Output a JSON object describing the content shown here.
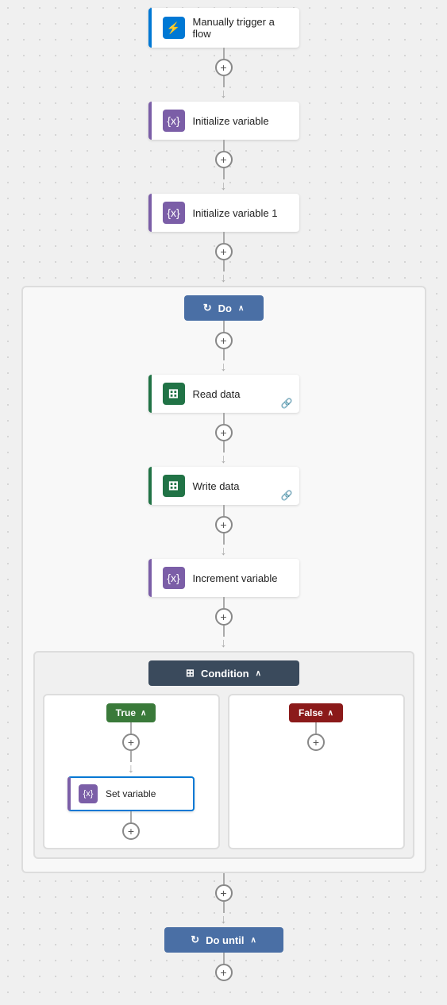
{
  "trigger": {
    "label": "Manually trigger a flow",
    "icon": "⚡",
    "iconColor": "#0078d4"
  },
  "initVariable": {
    "label": "Initialize variable",
    "iconLabel": "{x}",
    "iconColor": "#7B5EA7"
  },
  "initVariable1": {
    "label": "Initialize variable 1",
    "iconLabel": "{x}",
    "iconColor": "#7B5EA7"
  },
  "doBlock": {
    "label": "Do",
    "chevron": "∧"
  },
  "readData": {
    "label": "Read data",
    "iconLabel": "⊞",
    "iconColor": "#217346"
  },
  "writeData": {
    "label": "Write data",
    "iconLabel": "⊞",
    "iconColor": "#217346"
  },
  "incrementVariable": {
    "label": "Increment variable",
    "iconLabel": "{x}",
    "iconColor": "#7B5EA7"
  },
  "condition": {
    "label": "Condition",
    "chevron": "∧",
    "trueLabel": "True",
    "falseLabel": "False",
    "trueChevron": "∧",
    "falseChevron": "∧"
  },
  "setVariable": {
    "label": "Set variable",
    "iconLabel": "{x}",
    "iconColor": "#7B5EA7"
  },
  "doUntil": {
    "label": "Do until",
    "chevron": "∧"
  },
  "plusLabel": "+"
}
